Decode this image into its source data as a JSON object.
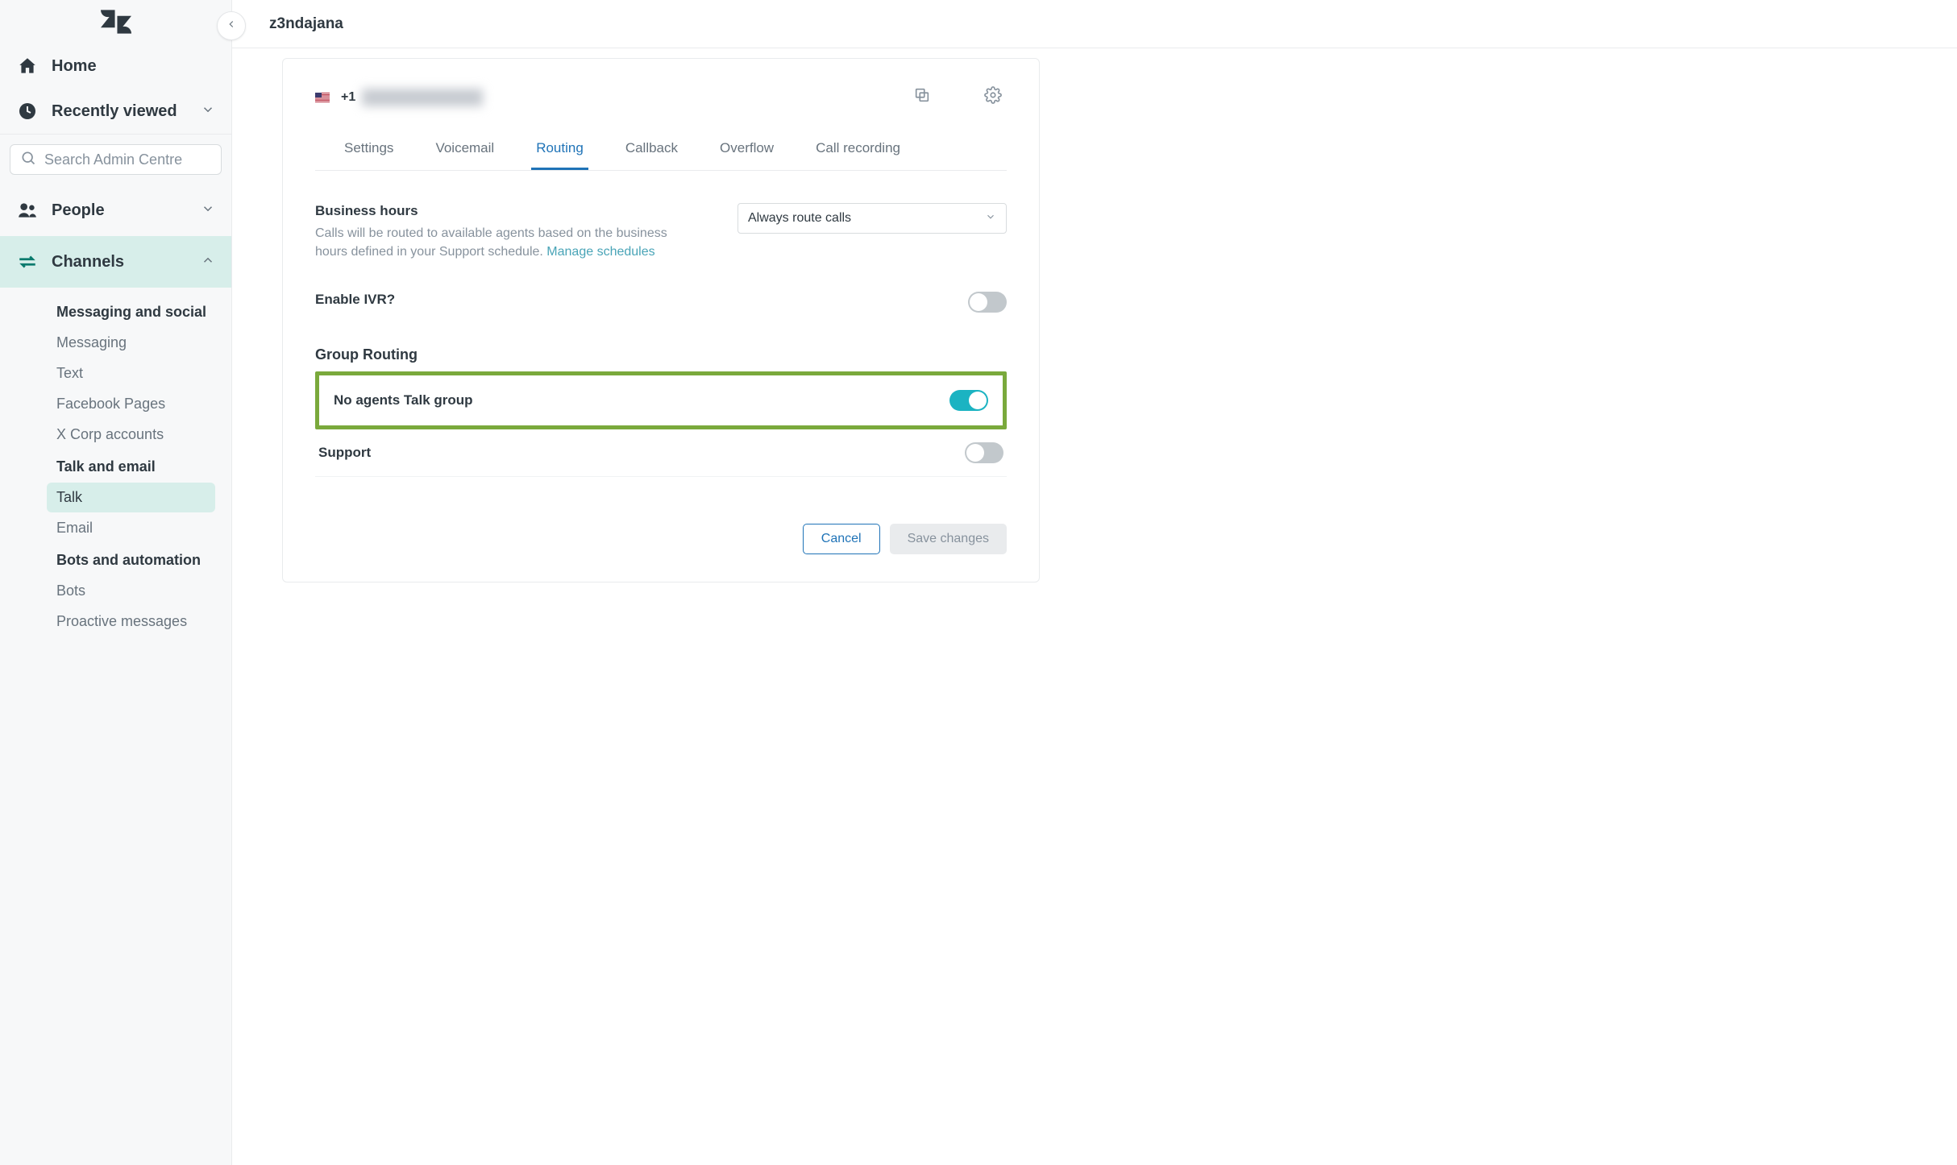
{
  "breadcrumb": "z3ndajana",
  "search": {
    "placeholder": "Search Admin Centre"
  },
  "nav": {
    "home": "Home",
    "recent": "Recently viewed",
    "people": "People",
    "channels": "Channels"
  },
  "channels": {
    "group_messaging_heading": "Messaging and social",
    "messaging": "Messaging",
    "text": "Text",
    "facebook": "Facebook Pages",
    "xcorp": "X Corp accounts",
    "group_talk_heading": "Talk and email",
    "talk": "Talk",
    "email": "Email",
    "group_bots_heading": "Bots and automation",
    "bots": "Bots",
    "proactive": "Proactive messages"
  },
  "phone": {
    "prefix": "+1"
  },
  "tabs": {
    "settings": "Settings",
    "voicemail": "Voicemail",
    "routing": "Routing",
    "callback": "Callback",
    "overflow": "Overflow",
    "recording": "Call recording"
  },
  "routing": {
    "business_hours_title": "Business hours",
    "business_hours_desc": "Calls will be routed to available agents based on the business hours defined in your Support schedule. ",
    "manage_schedules": "Manage schedules",
    "route_select_value": "Always route calls",
    "enable_ivr": "Enable IVR?",
    "group_routing_heading": "Group Routing",
    "group1": "No agents Talk group",
    "group2": "Support"
  },
  "actions": {
    "cancel": "Cancel",
    "save": "Save changes"
  }
}
